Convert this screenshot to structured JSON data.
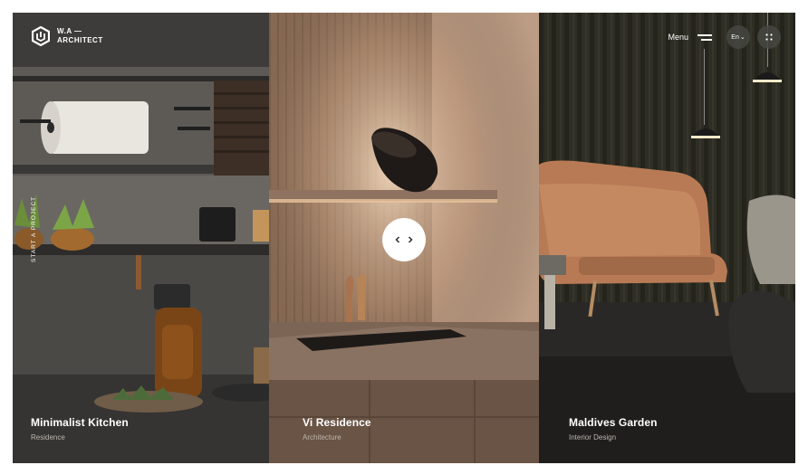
{
  "brand": {
    "line1": "W.A —",
    "line2": "ARCHITECT"
  },
  "header": {
    "menu_label": "Menu",
    "lang_label": "En",
    "lang_chevron": "⌄"
  },
  "side_cta": "START A PROJECT",
  "projects": [
    {
      "title": "Minimalist Kitchen",
      "category": "Residence"
    },
    {
      "title": "Vi Residence",
      "category": "Architecture"
    },
    {
      "title": "Maldives Garden",
      "category": "Interior Design"
    }
  ],
  "icons": {
    "logo": "hexagon-logo-icon",
    "menu": "hamburger-icon",
    "grid": "dots-grid-icon",
    "prev": "chevron-left-icon",
    "next": "chevron-right-icon"
  }
}
